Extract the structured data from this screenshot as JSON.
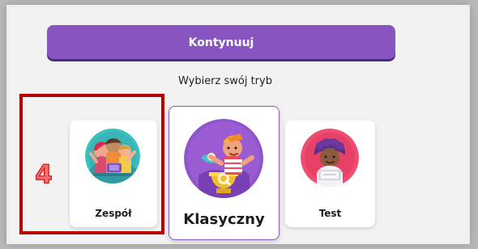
{
  "actions": {
    "continue_label": "Kontynuuj"
  },
  "mode_selection": {
    "prompt": "Wybierz swój tryb",
    "cards": [
      {
        "label": "Zespół",
        "icon": "team-mode-illustration-icon"
      },
      {
        "label": "Klasyczny",
        "icon": "classic-mode-illustration-icon"
      },
      {
        "label": "Test",
        "icon": "test-mode-illustration-icon"
      }
    ]
  },
  "annotation": {
    "number": "4"
  },
  "colors": {
    "panel_background": "#f2f2f2",
    "accent": "#8854c0",
    "accent_shadow": "#422370",
    "annotation_red": "#b60000",
    "annotation_number": "#ff6d6d"
  }
}
